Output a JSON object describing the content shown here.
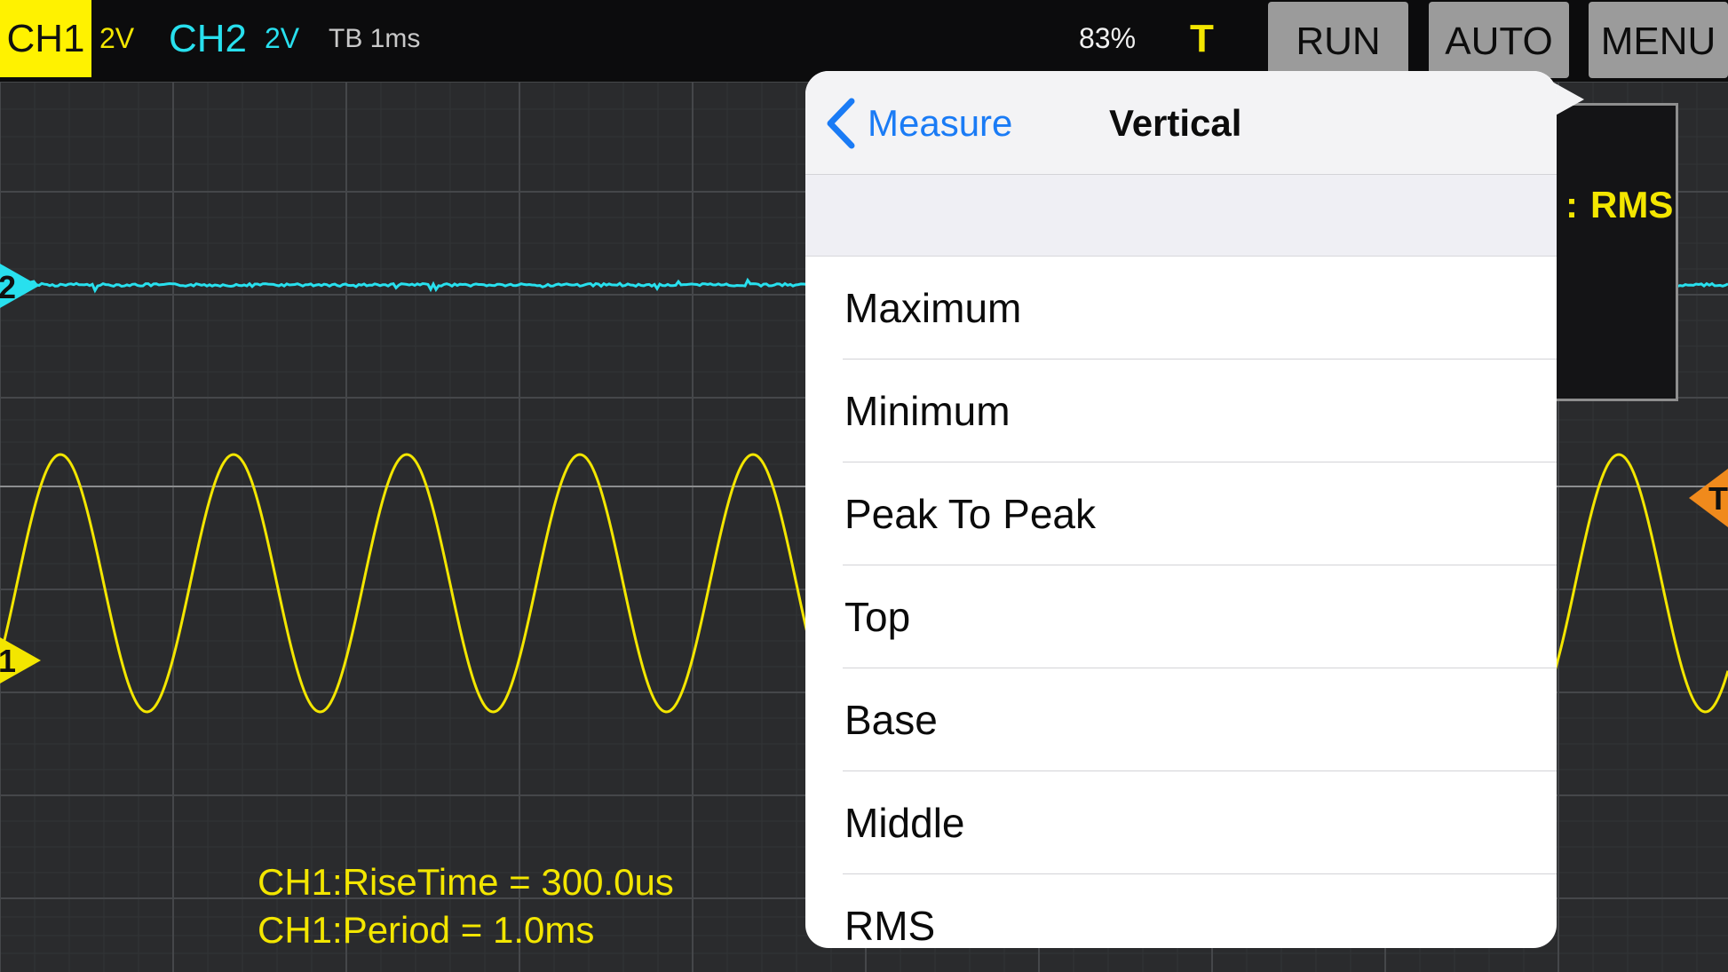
{
  "toolbar": {
    "ch1_label": "CH1",
    "ch1_scale": "2V",
    "ch2_label": "CH2",
    "ch2_scale": "2V",
    "timebase": "TB 1ms",
    "zoom": "83%",
    "trigger_label": "T",
    "run_label": "RUN",
    "auto_label": "AUTO",
    "menu_label": "MENU"
  },
  "markers": {
    "ch1": "1",
    "ch2": "2",
    "trigger": "T"
  },
  "measurements": [
    "CH1:RiseTime = 300.0us",
    "CH1:Period = 1.0ms"
  ],
  "side_panel": {
    "partial_text": "RMS"
  },
  "popover": {
    "back_label": "Measure",
    "title": "Vertical",
    "items": [
      "Maximum",
      "Minimum",
      "Peak To Peak",
      "Top",
      "Base",
      "Middle",
      "RMS"
    ]
  },
  "colors": {
    "ch1": "#f3e600",
    "ch2": "#28e0ee",
    "trigger": "#f08a1c",
    "grid": "#45474a",
    "background": "#2a2b2d"
  }
}
